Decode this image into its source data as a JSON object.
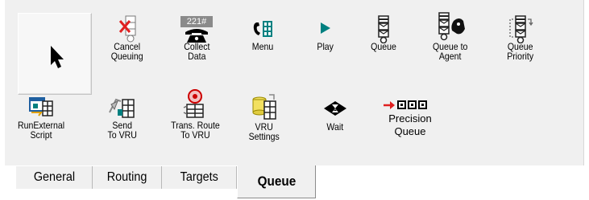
{
  "tools": [
    {
      "key": "select",
      "icon": "arrow-pointer-icon",
      "label": ""
    },
    {
      "key": "cancel_queuing",
      "icon": "cancel-queuing-icon",
      "label": "Cancel\nQueuing"
    },
    {
      "key": "collect_data",
      "icon": "collect-data-icon",
      "label": "Collect\nData",
      "icon_text": "221#"
    },
    {
      "key": "menu",
      "icon": "menu-phone-icon",
      "label": "Menu"
    },
    {
      "key": "play",
      "icon": "play-icon",
      "label": "Play"
    },
    {
      "key": "queue",
      "icon": "queue-icon",
      "label": "Queue"
    },
    {
      "key": "queue_to_agent",
      "icon": "queue-to-agent-icon",
      "label": "Queue to\nAgent"
    },
    {
      "key": "queue_priority",
      "icon": "queue-priority-icon",
      "label": "Queue\nPriority"
    },
    {
      "key": "run_external_script",
      "icon": "run-external-script-icon",
      "label": "RunExternal\nScript"
    },
    {
      "key": "send_to_vru",
      "icon": "send-to-vru-icon",
      "label": "Send\nTo VRU"
    },
    {
      "key": "trans_route_to_vru",
      "icon": "trans-route-to-vru-icon",
      "label": "Trans. Route\nTo VRU"
    },
    {
      "key": "vru_settings",
      "icon": "vru-settings-icon",
      "label": "VRU\nSettings"
    },
    {
      "key": "wait",
      "icon": "hourglass-wait-icon",
      "label": "Wait"
    },
    {
      "key": "precision_queue",
      "icon": "precision-queue-icon",
      "label": "Precision\nQueue"
    }
  ],
  "tabs": [
    {
      "key": "general",
      "label": "General"
    },
    {
      "key": "routing",
      "label": "Routing"
    },
    {
      "key": "targets",
      "label": "Targets"
    },
    {
      "key": "queue",
      "label": "Queue",
      "active": true
    }
  ],
  "colors": {
    "palette_bg": "#f0f0f0",
    "accent_red": "#e02020",
    "accent_teal": "#008080",
    "icon_dark": "#000000"
  }
}
